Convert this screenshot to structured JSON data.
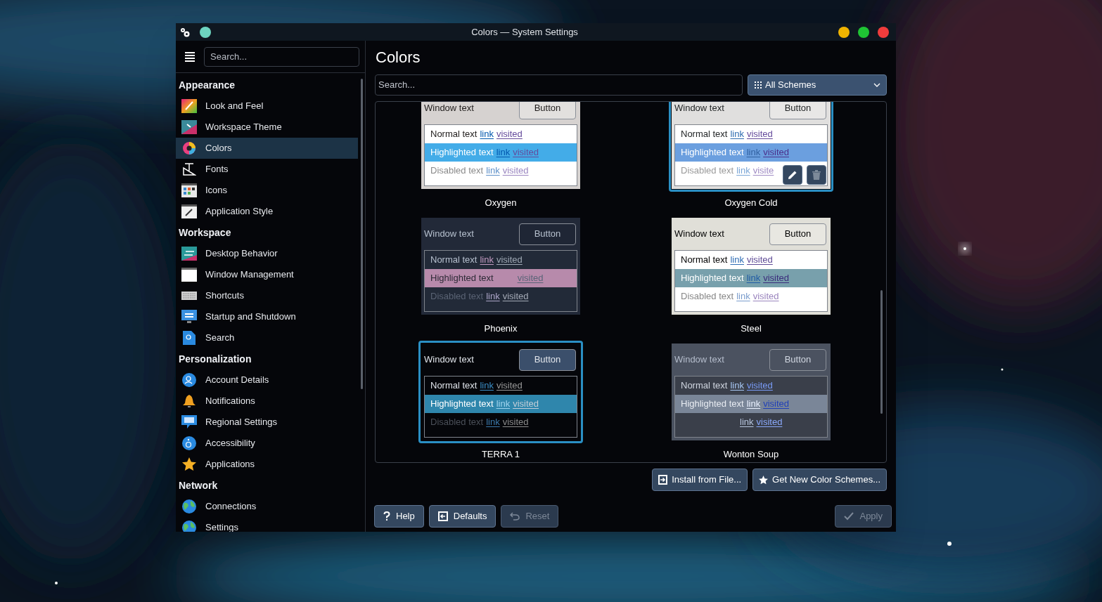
{
  "window": {
    "title": "Colors — System Settings"
  },
  "sidebar": {
    "search": {
      "placeholder": "Search..."
    },
    "sections": [
      {
        "title": "Appearance",
        "items": [
          {
            "label": "Look and Feel",
            "selected": false
          },
          {
            "label": "Workspace Theme",
            "selected": false
          },
          {
            "label": "Colors",
            "selected": true
          },
          {
            "label": "Fonts",
            "selected": false
          },
          {
            "label": "Icons",
            "selected": false
          },
          {
            "label": "Application Style",
            "selected": false
          }
        ]
      },
      {
        "title": "Workspace",
        "items": [
          {
            "label": "Desktop Behavior",
            "selected": false
          },
          {
            "label": "Window Management",
            "selected": false
          },
          {
            "label": "Shortcuts",
            "selected": false
          },
          {
            "label": "Startup and Shutdown",
            "selected": false
          },
          {
            "label": "Search",
            "selected": false
          }
        ]
      },
      {
        "title": "Personalization",
        "items": [
          {
            "label": "Account Details",
            "selected": false
          },
          {
            "label": "Notifications",
            "selected": false
          },
          {
            "label": "Regional Settings",
            "selected": false
          },
          {
            "label": "Accessibility",
            "selected": false
          },
          {
            "label": "Applications",
            "selected": false
          }
        ]
      },
      {
        "title": "Network",
        "items": [
          {
            "label": "Connections",
            "selected": false
          },
          {
            "label": "Settings",
            "selected": false
          }
        ]
      }
    ]
  },
  "page": {
    "title": "Colors",
    "search": {
      "placeholder": "Search..."
    },
    "filter": {
      "value": "All Schemes"
    },
    "schemes": [
      {
        "name": "Oxygen",
        "current": false,
        "hovered": false,
        "color": "#43ace8",
        "sample": {
          "window_text": "Window text",
          "button": "Button",
          "normal": "Normal text",
          "highlighted": "Highlighted text",
          "disabled": "Disabled text",
          "link": "link",
          "visited": "visited",
          "hl_link": "link",
          "hl_visited": "visited",
          "dis_link": "link",
          "dis_visited": "visited"
        }
      },
      {
        "name": "Oxygen Cold",
        "current": true,
        "hovered": true,
        "color": "#6b9fdf",
        "sample": {
          "window_text": "Window text",
          "button": "Button",
          "normal": "Normal text",
          "highlighted": "Highlighted text",
          "disabled": "Disabled text",
          "link": "link",
          "visited": "visited",
          "hl_link": "link",
          "hl_visited": "visited",
          "dis_link": "link",
          "dis_visited": "visite"
        }
      },
      {
        "name": "Phoenix",
        "current": false,
        "hovered": false,
        "color": "#b78aab",
        "sample": {
          "window_text": "Window text",
          "button": "Button",
          "normal": "Normal text",
          "highlighted": "Highlighted text",
          "disabled": "Disabled text",
          "link": "link",
          "visited": "visited",
          "hl_visited": "visited",
          "dis_link": "link",
          "dis_visited": "visited"
        }
      },
      {
        "name": "Steel",
        "current": false,
        "hovered": false,
        "color": "#78a0ac",
        "sample": {
          "window_text": "Window text",
          "button": "Button",
          "normal": "Normal text",
          "highlighted": "Highlighted text",
          "disabled": "Disabled text",
          "link": "link",
          "visited": "visited",
          "hl_link": "link",
          "hl_visited": "visited",
          "dis_link": "link",
          "dis_visited": "visited"
        }
      },
      {
        "name": "TERRA 1",
        "current": true,
        "hovered": false,
        "color": "#2f86ac",
        "sample": {
          "window_text": "Window text",
          "button": "Button",
          "normal": "Normal text",
          "highlighted": "Highlighted text",
          "disabled": "Disabled text",
          "link": "link",
          "visited": "visited",
          "hl_link": "link",
          "hl_visited": "visited",
          "dis_link": "link",
          "dis_visited": "visited"
        }
      },
      {
        "name": "Wonton Soup",
        "current": false,
        "hovered": false,
        "color": "#7a8698",
        "sample": {
          "window_text": "Window text",
          "button": "Button",
          "normal": "Normal text",
          "highlighted": "Highlighted text",
          "link": "link",
          "visited": "visited",
          "hl_link": "link",
          "hl_visited": "visited",
          "dis_link": "link",
          "dis_visited": "visited"
        }
      }
    ],
    "actions": [
      {
        "label": "Install from File..."
      },
      {
        "label": "Get New Color Schemes..."
      }
    ]
  },
  "footer": {
    "buttons": [
      {
        "label": "Help",
        "disabled": false
      },
      {
        "label": "Defaults",
        "disabled": false
      },
      {
        "label": "Reset",
        "disabled": true
      },
      {
        "label": "Apply",
        "disabled": true
      }
    ]
  }
}
